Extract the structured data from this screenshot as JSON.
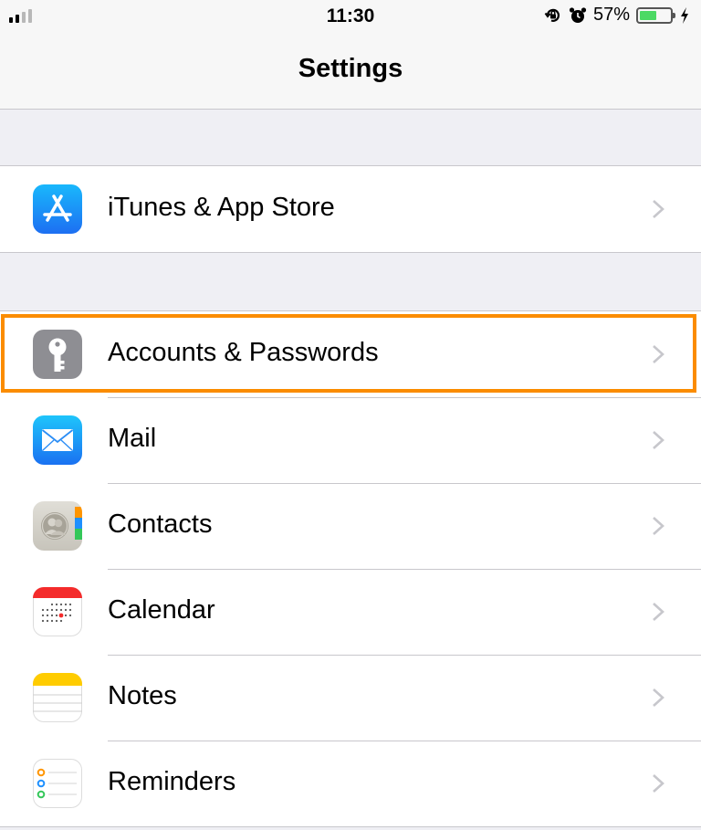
{
  "status_bar": {
    "time": "11:30",
    "battery_percent": "57%",
    "battery_level": 0.57,
    "signal_bars": 2,
    "icons": [
      "cellular-signal-icon",
      "orientation-lock-icon",
      "alarm-icon",
      "battery-icon",
      "charging-bolt-icon"
    ]
  },
  "nav": {
    "title": "Settings"
  },
  "groups": [
    {
      "items": [
        {
          "label": "iTunes & App Store",
          "icon": "app-store-icon"
        }
      ]
    },
    {
      "items": [
        {
          "label": "Accounts & Passwords",
          "icon": "key-icon",
          "highlighted": true
        },
        {
          "label": "Mail",
          "icon": "mail-icon"
        },
        {
          "label": "Contacts",
          "icon": "contacts-icon"
        },
        {
          "label": "Calendar",
          "icon": "calendar-icon"
        },
        {
          "label": "Notes",
          "icon": "notes-icon"
        },
        {
          "label": "Reminders",
          "icon": "reminders-icon"
        }
      ]
    }
  ],
  "colors": {
    "highlight": "#fb8c00",
    "background": "#efeff4",
    "chevron": "#c7c7cc",
    "battery_fill": "#4cd964"
  }
}
